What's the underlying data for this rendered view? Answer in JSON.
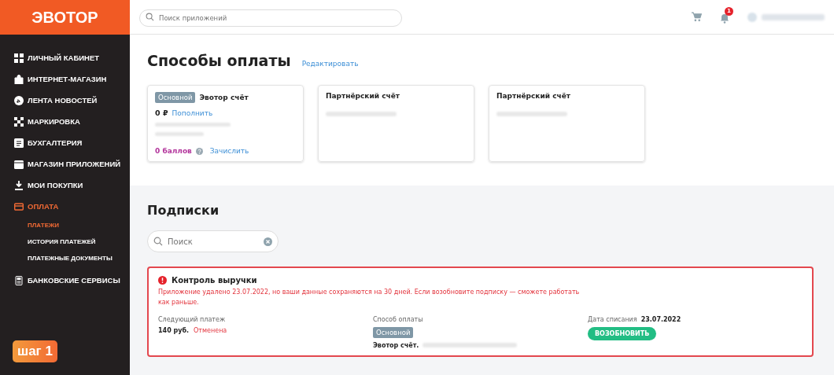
{
  "logo": "ЭВОТОР",
  "search": {
    "placeholder": "Поиск приложений"
  },
  "notifications": {
    "count": "1"
  },
  "sidebar": {
    "items": [
      {
        "label": "ЛИЧНЫЙ КАБИНЕТ",
        "selected": false
      },
      {
        "label": "ИНТЕРНЕТ-МАГАЗИН",
        "selected": false
      },
      {
        "label": "ЛЕНТА НОВОСТЕЙ",
        "selected": false
      },
      {
        "label": "МАРКИРОВКА",
        "selected": false
      },
      {
        "label": "БУХГАЛТЕРИЯ",
        "selected": false
      },
      {
        "label": "МАГАЗИН ПРИЛОЖЕНИЙ",
        "selected": false
      },
      {
        "label": "МОИ ПОКУПКИ",
        "selected": false
      },
      {
        "label": "ОПЛАТА",
        "selected": true,
        "children": [
          {
            "label": "ПЛАТЕЖИ",
            "selected": true
          },
          {
            "label": "ИСТОРИЯ ПЛАТЕЖЕЙ",
            "selected": false
          },
          {
            "label": "ПЛАТЕЖНЫЕ ДОКУМЕНТЫ",
            "selected": false
          }
        ]
      },
      {
        "label": "БАНКОВСКИЕ СЕРВИСЫ",
        "selected": false
      }
    ],
    "step_badge": "шаг 1"
  },
  "payment_methods": {
    "title": "Способы оплаты",
    "edit_link": "Редактировать",
    "cards": [
      {
        "badge": "Основной",
        "name": "Эвотор счёт",
        "balance": "0 ₽",
        "topup_link": "Пополнить",
        "points": "0 баллов",
        "credit_link": "Зачислить"
      },
      {
        "name": "Партнёрский счёт"
      },
      {
        "name": "Партнёрский счёт"
      }
    ]
  },
  "subscriptions": {
    "title": "Подписки",
    "search": {
      "placeholder": "Поиск"
    },
    "items": [
      {
        "title": "Контроль выручки",
        "warning": "Приложение удалено 23.07.2022, но ваши данные сохраняются на 30 дней. Если возобновите подписку — сможете работать как раньше.",
        "next_payment_label": "Следующий платеж",
        "amount": "140 руб.",
        "status": "Отменена",
        "method_label": "Способ оплаты",
        "method_badge": "Основной",
        "method_name": "Эвотор счёт.",
        "date_label": "Дата списания",
        "date": "23.07.2022",
        "renew_button": "ВОЗОБНОВИТЬ"
      }
    ]
  }
}
